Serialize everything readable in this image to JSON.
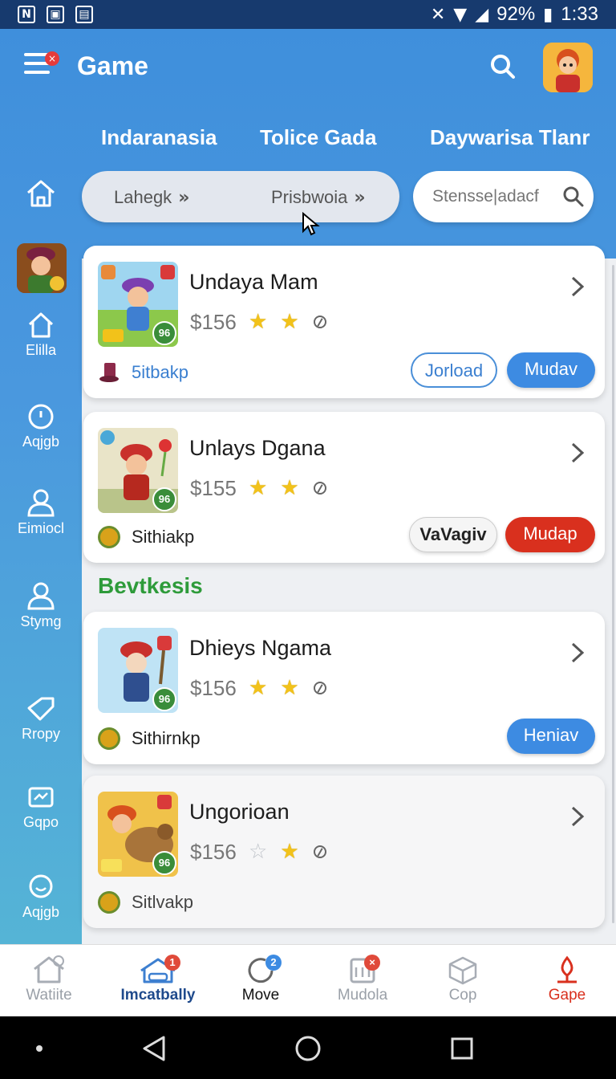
{
  "status_bar": {
    "battery": "92%",
    "time": "1:33",
    "left_icons": [
      "notification-n-icon",
      "notification-image-icon",
      "notification-gallery-icon"
    ]
  },
  "header": {
    "title": "Game",
    "menu_badge": "×"
  },
  "top_tabs": [
    "Indaranasia",
    "Tolice Gada",
    "Daywarisa Tlanr"
  ],
  "chips": [
    {
      "label": "Lahegk"
    },
    {
      "label": "Prisbwoia"
    }
  ],
  "search": {
    "placeholder": "Stensse|adacf"
  },
  "rail": {
    "items": [
      {
        "label": "",
        "icon": "home-icon"
      },
      {
        "label": "Elilla",
        "icon": "home-outline-icon"
      },
      {
        "label": "Aqjgb",
        "icon": "info-circle-icon"
      },
      {
        "label": "Eimiocl",
        "icon": "user-icon"
      },
      {
        "label": "Stymg",
        "icon": "user-icon"
      },
      {
        "label": "Rropy",
        "icon": "tag-icon"
      },
      {
        "label": "Gqpo",
        "icon": "chart-icon"
      },
      {
        "label": "Aqjgb",
        "icon": "search-icon"
      }
    ]
  },
  "cards": [
    {
      "title": "Undaya Mam",
      "price": "$156",
      "stars": [
        "full",
        "full"
      ],
      "seller": "5itbakp",
      "thumb_badge": "96",
      "buttons": [
        {
          "label": "Jorload",
          "style": "outline"
        },
        {
          "label": "Mudav",
          "style": "blue"
        }
      ]
    },
    {
      "title": "Unlays Dgana",
      "price": "$155",
      "stars": [
        "full",
        "full"
      ],
      "seller": "Sithiakp",
      "thumb_badge": "96",
      "buttons": [
        {
          "label": "VaVagiv",
          "style": "light"
        },
        {
          "label": "Mudap",
          "style": "red"
        }
      ]
    },
    {
      "title": "Dhieys Ngama",
      "price": "$156",
      "stars": [
        "full",
        "full"
      ],
      "seller": "Sithirnkp",
      "thumb_badge": "96",
      "buttons": [
        {
          "label": "Heniav",
          "style": "blue"
        }
      ]
    },
    {
      "title": "Ungorioan",
      "price": "$156",
      "stars": [
        "empty",
        "full"
      ],
      "seller": "Sitlvakp",
      "thumb_badge": "96",
      "buttons": []
    }
  ],
  "section_heading": "Bevtkesis",
  "bottom_nav": [
    {
      "label": "Watiite",
      "icon": "home-icon",
      "badge": ""
    },
    {
      "label": "Imcatbally",
      "icon": "house-car-icon",
      "badge": "1"
    },
    {
      "label": "Move",
      "icon": "refresh-icon",
      "badge": "2"
    },
    {
      "label": "Mudola",
      "icon": "calendar-icon",
      "badge": "×"
    },
    {
      "label": "Cop",
      "icon": "box-icon",
      "badge": ""
    },
    {
      "label": "Gape",
      "icon": "pin-icon",
      "badge": ""
    }
  ],
  "colors": {
    "header_blue": "#3f8fdc",
    "accent_blue": "#3d8be2",
    "accent_red": "#d9301e",
    "section_green": "#2e9b3a",
    "star_yellow": "#f2c21a"
  }
}
